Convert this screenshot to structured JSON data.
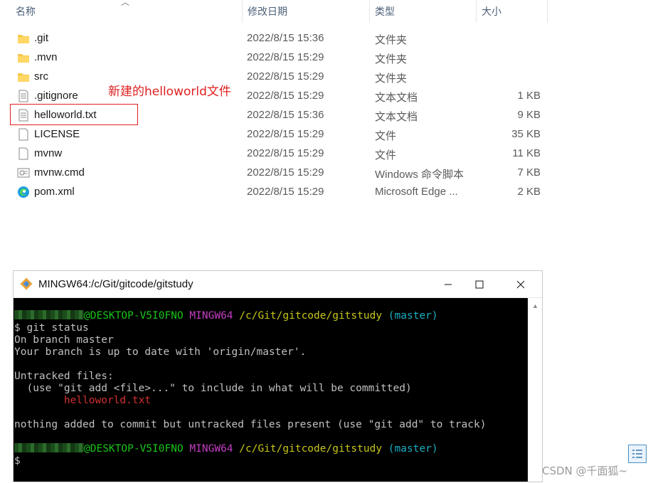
{
  "explorer": {
    "columns": [
      "名称",
      "修改日期",
      "类型",
      "大小"
    ],
    "files": [
      {
        "name": ".git",
        "date": "2022/8/15 15:36",
        "type": "文件夹",
        "size": "",
        "icon": "folder-icon"
      },
      {
        "name": ".mvn",
        "date": "2022/8/15 15:29",
        "type": "文件夹",
        "size": "",
        "icon": "folder-icon"
      },
      {
        "name": "src",
        "date": "2022/8/15 15:29",
        "type": "文件夹",
        "size": "",
        "icon": "folder-icon"
      },
      {
        "name": ".gitignore",
        "date": "2022/8/15 15:29",
        "type": "文本文档",
        "size": "1 KB",
        "icon": "text-file-icon"
      },
      {
        "name": "helloworld.txt",
        "date": "2022/8/15 15:36",
        "type": "文本文档",
        "size": "9 KB",
        "icon": "text-file-icon"
      },
      {
        "name": "LICENSE",
        "date": "2022/8/15 15:29",
        "type": "文件",
        "size": "35 KB",
        "icon": "blank-file-icon"
      },
      {
        "name": "mvnw",
        "date": "2022/8/15 15:29",
        "type": "文件",
        "size": "11 KB",
        "icon": "blank-file-icon"
      },
      {
        "name": "mvnw.cmd",
        "date": "2022/8/15 15:29",
        "type": "Windows 命令脚本",
        "size": "7 KB",
        "icon": "cmd-file-icon"
      },
      {
        "name": "pom.xml",
        "date": "2022/8/15 15:29",
        "type": "Microsoft Edge ...",
        "size": "2 KB",
        "icon": "edge-icon"
      }
    ],
    "annotation": "新建的helloworld文件"
  },
  "terminal": {
    "title": "MINGW64:/c/Git/gitcode/gitstudy",
    "prompt": {
      "host": "@DESKTOP-V5I0FNO",
      "shell": "MINGW64",
      "path": "/c/Git/gitcode/gitstudy",
      "branch": "(master)"
    },
    "lines": [
      "$ git status",
      "On branch master",
      "Your branch is up to date with 'origin/master'.",
      "",
      "Untracked files:",
      "  (use \"git add <file>...\" to include in what will be committed)",
      "        helloworld.txt",
      "",
      "nothing added to commit but untracked files present (use \"git add\" to track)",
      "",
      "$"
    ]
  },
  "watermark": "CSDN @千面狐~"
}
